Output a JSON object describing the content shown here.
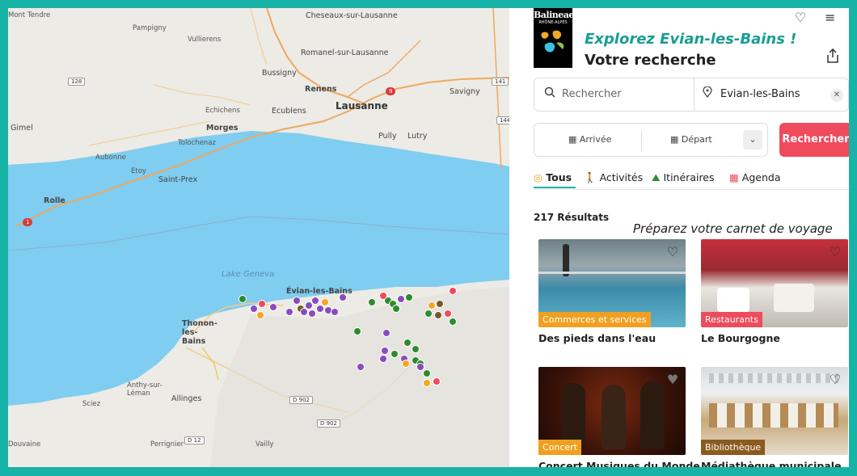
{
  "app": {
    "brand_line1": "Balineae",
    "brand_line2": "RHÔNE-ALPES",
    "headline": "Explorez Evian-les-Bains !",
    "subheadline": "Votre recherche"
  },
  "icons": {
    "heart": "heart-icon",
    "menu": "menu-icon",
    "share": "share-icon",
    "search": "search-icon",
    "location": "location-pin-icon",
    "clear": "close-icon",
    "calendar": "calendar-icon",
    "chevron": "chevron-down-icon"
  },
  "search": {
    "keyword_placeholder": "Rechercher",
    "location_value": "Evian-les-Bains",
    "arrival_label": "Arrivée",
    "departure_label": "Départ",
    "search_button": "Rechercher"
  },
  "tabs": [
    {
      "label": "Tous"
    },
    {
      "label": "Activités"
    },
    {
      "label": "Itinéraires"
    },
    {
      "label": "Agenda"
    }
  ],
  "results": {
    "count": "217 Résultats",
    "promo": "Préparez votre carnet de voyage"
  },
  "cards": [
    {
      "category": "Commerces et services",
      "title": "Des pieds dans l'eau",
      "color": "#f0a020"
    },
    {
      "category": "Restaurants",
      "title": "Le Bourgogne",
      "color": "#ee4b5c"
    },
    {
      "category": "Concert",
      "title": "Concert Musiques du Monde",
      "color": "#f0a020"
    },
    {
      "category": "Bibliothèque",
      "title": "Médiathèque municipale",
      "color": "#8a5a1e"
    }
  ],
  "map": {
    "lake_label": "Lake Geneva",
    "places": [
      "Mont Tendre",
      "Cheseaux-sur-Lausanne",
      "Pampigny",
      "Vullierens",
      "Romanel-sur-Lausanne",
      "Bussigny",
      "Renens",
      "Lausanne",
      "Savigny",
      "Echichens",
      "Ecublens",
      "Gimel",
      "Morges",
      "Pully",
      "Lutry",
      "Tolochenaz",
      "Aubonne",
      "Etoy",
      "Saint-Prex",
      "Rolle",
      "Évian-les-Bains",
      "Thonon-les-Bains",
      "Anthy-sur-Léman",
      "Allinges",
      "Sciez",
      "Perrignier",
      "Vailly",
      "Douvaine"
    ],
    "roads": [
      "128",
      "141",
      "144",
      "9",
      "1",
      "D 902",
      "D 902",
      "D 12"
    ],
    "colors": {
      "water": "#7fcdf0",
      "land": "#ecebe6",
      "green": "#2e8b2e",
      "purple": "#8b4bbf",
      "pink": "#ee4b5c",
      "orange": "#f5a623",
      "brown": "#7a5a20"
    }
  }
}
